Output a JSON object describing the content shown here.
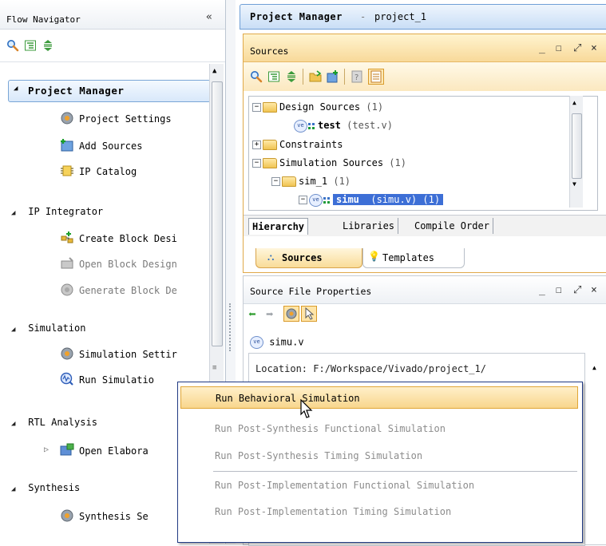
{
  "flow_navigator": {
    "title": "Flow Navigator",
    "collapse_label": "«",
    "sections": {
      "project_manager": {
        "label": "Project Manager",
        "items": [
          "Project Settings",
          "Add Sources",
          "IP Catalog"
        ]
      },
      "ip_integrator": {
        "label": "IP Integrator",
        "items": [
          "Create Block Desi",
          "Open Block Design",
          "Generate Block De"
        ]
      },
      "simulation": {
        "label": "Simulation",
        "items": [
          "Simulation Settir",
          "Run Simulatio"
        ]
      },
      "rtl_analysis": {
        "label": "RTL Analysis",
        "items": [
          "Open Elabora"
        ]
      },
      "synthesis": {
        "label": "Synthesis",
        "items": [
          "Synthesis Se"
        ]
      }
    }
  },
  "project_manager": {
    "title": "Project Manager",
    "separator": "-",
    "project_name": "project_1"
  },
  "sources_panel": {
    "title": "Sources",
    "controls": {
      "minimize": "_",
      "maximize": "☐",
      "float": "⤢",
      "close": "×"
    },
    "tree": [
      {
        "label": "Design Sources",
        "count": "(1)"
      },
      {
        "label": "test",
        "file": "(test.v)"
      },
      {
        "label": "Constraints"
      },
      {
        "label": "Simulation Sources",
        "count": "(1)"
      },
      {
        "label": "sim_1",
        "count": "(1)"
      },
      {
        "label": "simu",
        "file": "(simu.v)",
        "count": "(1)"
      }
    ],
    "tabs": [
      "Hierarchy",
      "Libraries",
      "Compile Order"
    ],
    "bottom_tabs": [
      "Sources",
      "Templates"
    ]
  },
  "properties_panel": {
    "title": "Source File Properties",
    "file_name": "simu.v",
    "location_text": "Location:   F:/Workspace/Vivado/project_1/"
  },
  "context_menu": {
    "items": [
      "Run Behavioral Simulation",
      "Run Post-Synthesis Functional Simulation",
      "Run Post-Synthesis Timing Simulation",
      "Run Post-Implementation Functional Simulation",
      "Run Post-Implementation Timing Simulation"
    ]
  },
  "icon_badge_text": "ve",
  "colors": {
    "selection": "#3d6fd6",
    "menu_highlight": "#f8d68d",
    "panel_active": "#f8d99a",
    "header_blue": "#c9def6"
  }
}
